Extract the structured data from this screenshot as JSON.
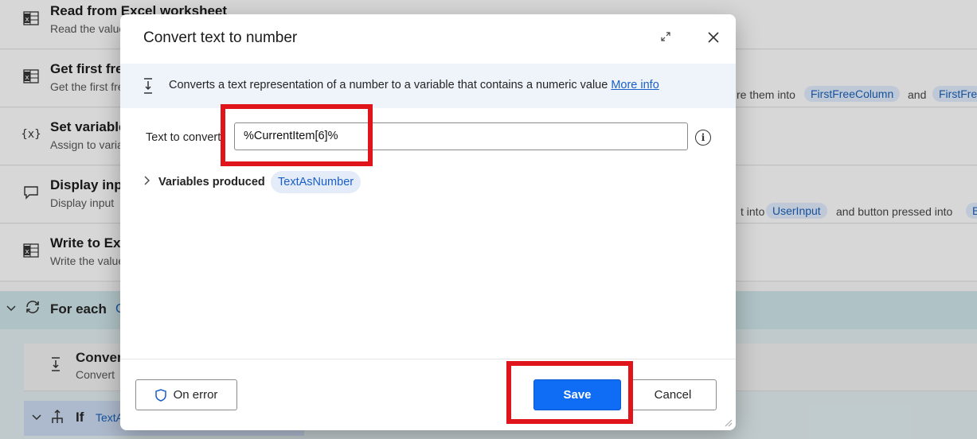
{
  "background": {
    "steps": [
      {
        "title": "Read from Excel worksheet",
        "desc": "Read the value"
      },
      {
        "title": "Get first free",
        "desc": "Get the first free"
      },
      {
        "title": "Set variable",
        "desc": "Assign to variable"
      },
      {
        "title": "Display input",
        "desc": "Display input"
      },
      {
        "title": "Write to Excel",
        "desc": "Write the value"
      }
    ],
    "step2_right_text": "re them into",
    "step2_chip1": "FirstFreeColumn",
    "step2_and": "and",
    "step2_chip2": "FirstFre",
    "step4_right_text": "t into",
    "step4_chip1": "UserInput",
    "step4_right_text2": "and button pressed into",
    "step4_chip2": "B",
    "foreach_title": "For each",
    "foreach_extra": "C",
    "inner_title": "Convert",
    "inner_desc": "Convert",
    "if_title": "If",
    "if_extra": "TextA"
  },
  "dialog": {
    "title": "Convert text to number",
    "info_text": "Converts a text representation of a number to a variable that contains a numeric value",
    "info_link": "More info",
    "field_label": "Text to convert",
    "field_value": "%CurrentItem[6]%",
    "info_icon_glyph": "i",
    "variables_label": "Variables produced",
    "variable_chip": "TextAsNumber",
    "on_error_label": "On error",
    "save_label": "Save",
    "cancel_label": "Cancel"
  },
  "colors": {
    "accent": "#0f6cf5",
    "highlight": "#e0141b",
    "link": "#1a5fc7"
  }
}
